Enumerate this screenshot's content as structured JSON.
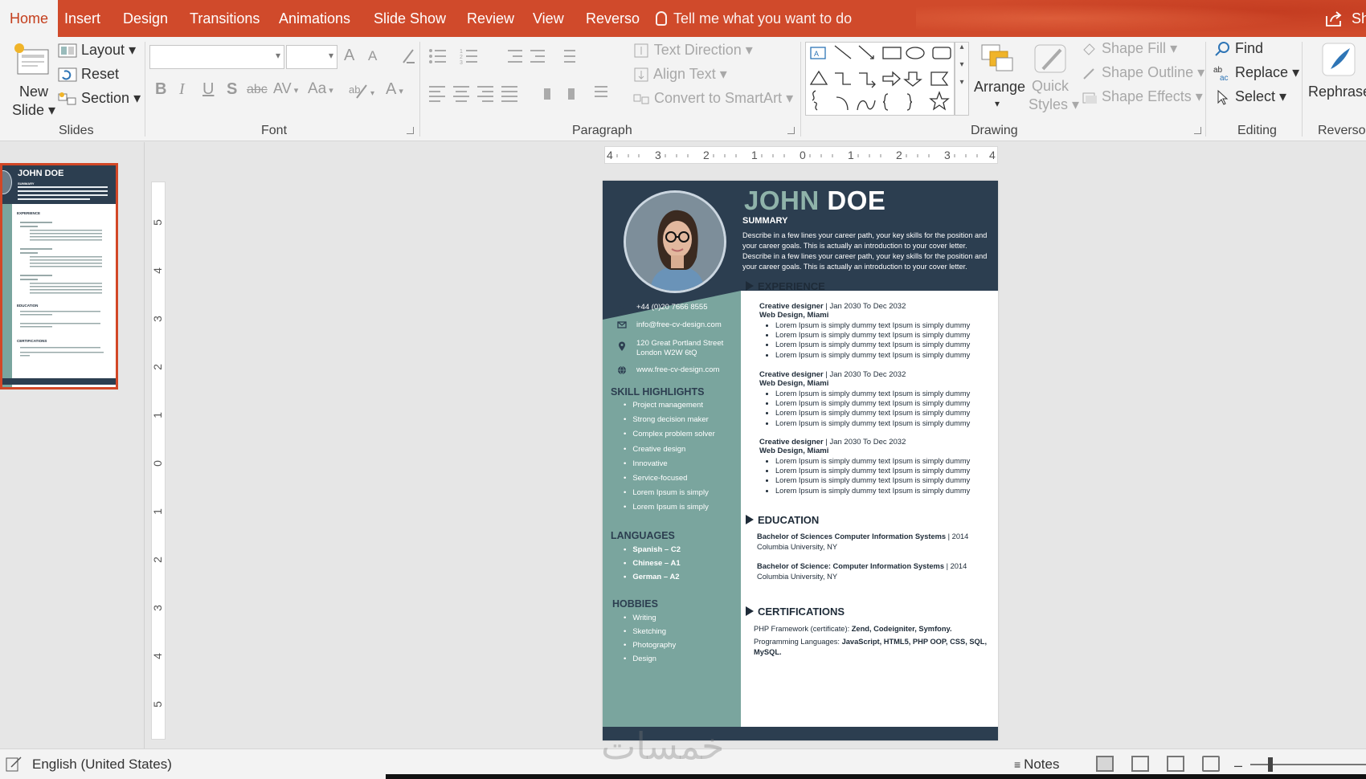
{
  "tabs": [
    "Home",
    "Insert",
    "Design",
    "Transitions",
    "Animations",
    "Slide Show",
    "Review",
    "View",
    "Reverso"
  ],
  "tell_me": "Tell me what you want to do",
  "share_label": "Sh",
  "ribbon": {
    "slides": {
      "new_slide_1": "New",
      "new_slide_2": "Slide",
      "layout": "Layout",
      "reset": "Reset",
      "section": "Section",
      "group": "Slides"
    },
    "font": {
      "grow": "A",
      "shrink": "A",
      "bold": "B",
      "italic": "I",
      "underline": "U",
      "shadow": "S",
      "strike": "abc",
      "spacing": "AV",
      "case": "Aa",
      "color": "A",
      "group": "Font"
    },
    "paragraph": {
      "text_direction": "Text Direction",
      "align_text": "Align Text",
      "convert_smartart": "Convert to SmartArt",
      "group": "Paragraph"
    },
    "drawing": {
      "arrange": "Arrange",
      "quick_styles_1": "Quick",
      "quick_styles_2": "Styles",
      "shape_fill": "Shape Fill",
      "shape_outline": "Shape Outline",
      "shape_effects": "Shape Effects",
      "group": "Drawing"
    },
    "editing": {
      "find": "Find",
      "replace": "Replace",
      "select": "Select",
      "group": "Editing"
    },
    "reverso": {
      "rephrase": "Rephrase",
      "group": "Reverso"
    }
  },
  "hruler": [
    "4",
    "3",
    "2",
    "1",
    "0",
    "1",
    "2",
    "3",
    "4"
  ],
  "vruler": [
    "5",
    "4",
    "3",
    "2",
    "1",
    "0",
    "1",
    "2",
    "3",
    "4",
    "5"
  ],
  "resume": {
    "first_name": "JOHN",
    "last_name": " DOE",
    "summary_heading": "SUMMARY",
    "summary_text": "Describe in a few lines your career path, your key skills for the position and your career goals. This is actually an introduction to your cover letter. Describe in a few lines your career path, your key skills for the position and your career goals. This is actually an introduction to your cover letter.",
    "contact": {
      "phone": "+44 (0)20 7666 8555",
      "email": "info@free-cv-design.com",
      "address_1": "120 Great Portland Street",
      "address_2": "London W2W 6tQ",
      "website": "www.free-cv-design.com"
    },
    "skill_heading": "SKILL HIGHLIGHTS",
    "skills": [
      "Project management",
      "Strong decision maker",
      "Complex problem solver",
      "Creative design",
      "Innovative",
      "Service-focused",
      "Lorem Ipsum is simply",
      "Lorem Ipsum is simply"
    ],
    "languages_heading": "LANGUAGES",
    "languages": [
      "Spanish – C2",
      "Chinese – A1",
      "German – A2"
    ],
    "hobbies_heading": "HOBBIES",
    "hobbies": [
      "Writing",
      "Sketching",
      "Photography",
      "Design"
    ],
    "experience_heading": "EXPERIENCE",
    "jobs": [
      {
        "title": "Creative designer",
        "dates": " | Jan 2030 To Dec 2032",
        "company": "Web Design, Miami",
        "bullets": [
          "Lorem Ipsum is simply dummy text Ipsum is simply dummy",
          "Lorem Ipsum is simply dummy text Ipsum is simply dummy",
          "Lorem Ipsum is simply dummy text Ipsum is simply dummy",
          "Lorem Ipsum is simply dummy text Ipsum is simply dummy"
        ]
      },
      {
        "title": "Creative designer",
        "dates": " | Jan 2030 To Dec 2032",
        "company": "Web Design, Miami",
        "bullets": [
          "Lorem Ipsum is simply dummy text Ipsum is simply dummy",
          "Lorem Ipsum is simply dummy text Ipsum is simply dummy",
          "Lorem Ipsum is simply dummy text Ipsum is simply dummy",
          "Lorem Ipsum is simply dummy text Ipsum is simply dummy"
        ]
      },
      {
        "title": "Creative designer",
        "dates": " | Jan 2030 To Dec 2032",
        "company": "Web Design, Miami",
        "bullets": [
          "Lorem Ipsum is simply dummy text Ipsum is simply dummy",
          "Lorem Ipsum is simply dummy text Ipsum is simply dummy",
          "Lorem Ipsum is simply dummy text Ipsum is simply dummy",
          "Lorem Ipsum is simply dummy text Ipsum is simply dummy"
        ]
      }
    ],
    "education_heading": "EDUCATION",
    "education": [
      {
        "degree": "Bachelor of Sciences Computer Information Systems",
        "year": " | 2014",
        "school": "Columbia University, NY"
      },
      {
        "degree": "Bachelor of Science: Computer Information Systems",
        "year": " | 2014",
        "school": "Columbia University, NY"
      }
    ],
    "certifications_heading": "CERTIFICATIONS",
    "cert_1_label": "PHP Framework (certificate): ",
    "cert_1_value": "Zend, Codeigniter, Symfony.",
    "cert_2_label": "Programming Languages: ",
    "cert_2_value": "JavaScript, HTML5, PHP OOP, CSS, SQL, MySQL."
  },
  "thumbnail": {
    "name": "JOHN DOE",
    "summary": "SUMMARY",
    "experience": "EXPERIENCE",
    "education": "EDUCATION",
    "certifications": "CERTIFICATIONS"
  },
  "status": {
    "language": "English (United States)",
    "notes": "Notes"
  },
  "colors": {
    "accent": "#d04a2b",
    "resume_navy": "#2c3e50",
    "resume_teal": "#7aa59e"
  }
}
